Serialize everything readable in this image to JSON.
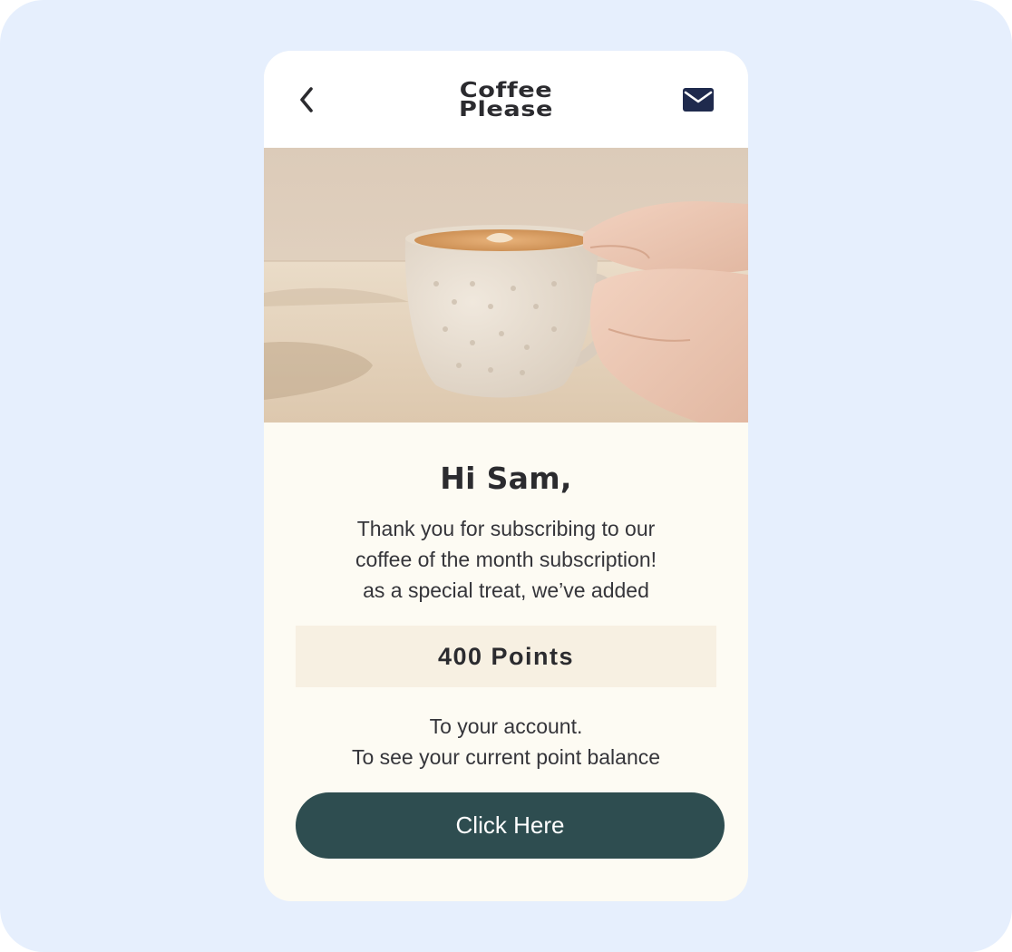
{
  "header": {
    "back_icon": "chevron-left-icon",
    "logo_line1": "Coffee",
    "logo_line2": "Please",
    "mail_icon": "envelope-icon"
  },
  "hero": {
    "subject": "latte-cup-photo"
  },
  "email": {
    "greeting": "Hi Sam,",
    "message_lines": [
      "Thank you for subscribing to our",
      "coffee of the month subscription!",
      "as a special treat, we’ve added"
    ],
    "points_label": "400 Points",
    "footer_lines": [
      "To your account.",
      "To see your current point balance"
    ],
    "cta_label": "Click Here"
  },
  "colors": {
    "backdrop": "#e6effd",
    "card": "#fdfbf3",
    "points_box": "#f7f0e2",
    "cta": "#2e4d50",
    "icon_navy": "#1f2a4d",
    "text": "#2b2b2f"
  }
}
